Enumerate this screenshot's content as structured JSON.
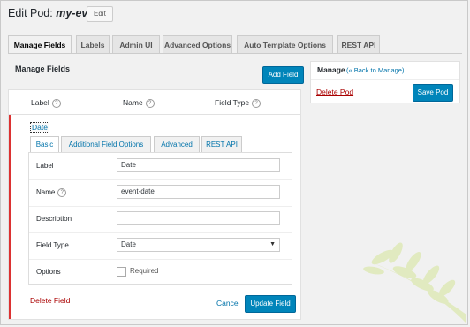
{
  "header": {
    "title_prefix": "Edit Pod:",
    "pod_name": "my-event",
    "edit_label": "Edit"
  },
  "tabs": [
    {
      "label": "Manage Fields",
      "active": true
    },
    {
      "label": "Labels"
    },
    {
      "label": "Admin UI"
    },
    {
      "label": "Advanced Options"
    },
    {
      "label": "Auto Template Options"
    },
    {
      "label": "REST API"
    }
  ],
  "manage_fields": {
    "heading": "Manage Fields",
    "add_field_label": "Add Field",
    "columns": [
      "Label",
      "Name",
      "Field Type"
    ],
    "row_title": "Date",
    "field_tabs": [
      "Basic",
      "Additional Field Options",
      "Advanced",
      "REST API"
    ],
    "form": {
      "label": {
        "label": "Label",
        "value": "Date"
      },
      "name": {
        "label": "Name",
        "value": "event-date"
      },
      "description": {
        "label": "Description",
        "value": ""
      },
      "field_type": {
        "label": "Field Type",
        "value": "Date"
      },
      "options": {
        "label": "Options",
        "required_label": "Required"
      }
    },
    "delete_field_label": "Delete Field",
    "cancel_label": "Cancel",
    "update_field_label": "Update Field"
  },
  "manage_box": {
    "title": "Manage",
    "back_link": "(« Back to Manage)",
    "delete_pod_label": "Delete Pod",
    "save_pod_label": "Save Pod"
  },
  "colors": {
    "primary": "#0085ba",
    "link": "#0073aa",
    "danger": "#a00",
    "accent_bar": "#dc3232"
  }
}
